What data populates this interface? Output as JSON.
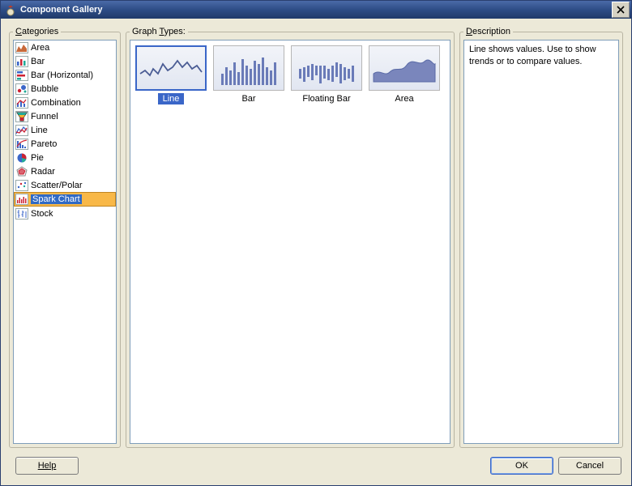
{
  "title": "Component Gallery",
  "panels": {
    "categories": {
      "prefix": "C",
      "mnemonic": "",
      "rest": "ategories"
    },
    "types": {
      "prefix": "Graph ",
      "mnemonic": "T",
      "rest": "ypes:"
    },
    "description": {
      "prefix": "",
      "mnemonic": "D",
      "rest": "escription"
    }
  },
  "categories": [
    {
      "id": "area",
      "label": "Area"
    },
    {
      "id": "bar",
      "label": "Bar"
    },
    {
      "id": "bar-horizontal",
      "label": "Bar (Horizontal)"
    },
    {
      "id": "bubble",
      "label": "Bubble"
    },
    {
      "id": "combination",
      "label": "Combination"
    },
    {
      "id": "funnel",
      "label": "Funnel"
    },
    {
      "id": "line",
      "label": "Line"
    },
    {
      "id": "pareto",
      "label": "Pareto"
    },
    {
      "id": "pie",
      "label": "Pie"
    },
    {
      "id": "radar",
      "label": "Radar"
    },
    {
      "id": "scatter-polar",
      "label": "Scatter/Polar"
    },
    {
      "id": "spark-chart",
      "label": "Spark Chart",
      "selected": true
    },
    {
      "id": "stock",
      "label": "Stock"
    }
  ],
  "graph_types": [
    {
      "id": "line",
      "label": "Line",
      "selected": true
    },
    {
      "id": "bar",
      "label": "Bar"
    },
    {
      "id": "floating-bar",
      "label": "Floating Bar"
    },
    {
      "id": "area",
      "label": "Area"
    }
  ],
  "description": "Line shows values. Use to show trends or to compare values.",
  "buttons": {
    "help": "Help",
    "ok": "OK",
    "cancel": "Cancel"
  }
}
